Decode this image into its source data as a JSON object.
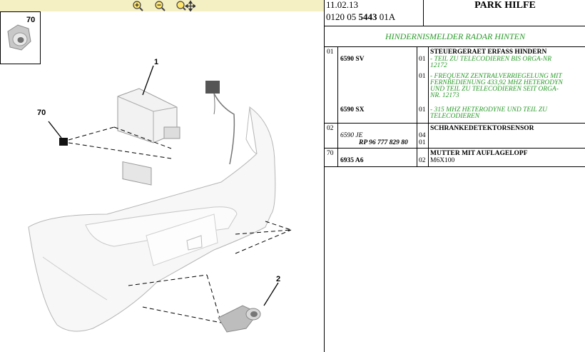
{
  "toolbar": {
    "zoom_in": "zoom-in-icon",
    "zoom_out": "zoom-out-icon",
    "zoom_pan": "zoom-pan-icon",
    "bg": "#f5efc4"
  },
  "drawing": {
    "callouts": [
      "70",
      "1",
      "70",
      "2"
    ]
  },
  "header": {
    "date": "11.02.13",
    "code_prefix": "0120 05 ",
    "code_bold": "5443",
    "code_suffix": " 01A",
    "title": "PARK HILFE"
  },
  "subtitle": "HINDERNISMELDER RADAR HINTEN",
  "rows": [
    {
      "pos": "01",
      "refs": [
        "6590 SV",
        "6590 SX"
      ],
      "qty": [
        "01",
        "01",
        "01"
      ],
      "name": "STEUERGERAET ERFASS HINDERN",
      "notes": [
        "- TEIL ZU TELECODIEREN BIS ORGA-NR",
        "12172",
        "- FREQUENZ ZENTRALVERRIEGELUNG MIT",
        "FERNBEDIENUNG 433,92 MHZ HETERODYN",
        "UND TEIL ZU TELECODIEREN SEIT ORGA-",
        "NR. 12173",
        "- 315 MHZ HETERODYNE UND TEIL ZU",
        "TELECODIEREN"
      ]
    },
    {
      "pos": "02",
      "refs": [
        "6590 JE",
        "RP 96 777 829 80"
      ],
      "qty": [
        "04",
        "01"
      ],
      "name": "SCHRANKEDETEKTORSENSOR"
    },
    {
      "pos": "70",
      "refs": [
        "6935 A6"
      ],
      "qty": [
        "02"
      ],
      "name": "MUTTER MIT AUFLAGELOPF",
      "detail": "M6X100"
    }
  ],
  "colors": {
    "green": "#2a9a2a",
    "border": "#000000"
  }
}
